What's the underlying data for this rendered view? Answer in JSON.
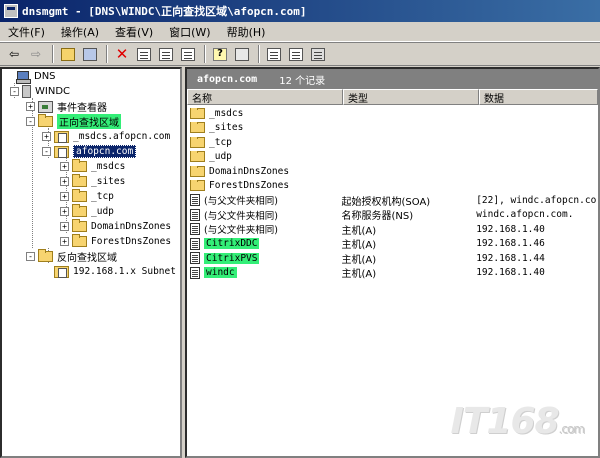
{
  "window": {
    "title": "dnsmgmt - [DNS\\WINDC\\正向查找区域\\afopcn.com]"
  },
  "menu": [
    "文件(F)",
    "操作(A)",
    "查看(V)",
    "窗口(W)",
    "帮助(H)"
  ],
  "tree": {
    "root": "DNS",
    "server": "WINDC",
    "event_viewer": "事件查看器",
    "forward_zone": "正向查找区域",
    "msdcs_zone": "_msdcs.afopcn.com",
    "selected_zone": "afopcn.com",
    "subfolders": [
      "_msdcs",
      "_sites",
      "_tcp",
      "_udp",
      "DomainDnsZones",
      "ForestDnsZones"
    ],
    "reverse_zone": "反向查找区域",
    "reverse_subnet": "192.168.1.x Subnet"
  },
  "right_pane": {
    "zone_name": "afopcn.com",
    "record_count": "12 个记录",
    "columns": {
      "name": "名称",
      "type": "类型",
      "data": "数据"
    },
    "rows": [
      {
        "name": "_msdcs",
        "type": "",
        "data": "",
        "kind": "folder",
        "highlight": false
      },
      {
        "name": "_sites",
        "type": "",
        "data": "",
        "kind": "folder",
        "highlight": false
      },
      {
        "name": "_tcp",
        "type": "",
        "data": "",
        "kind": "folder",
        "highlight": false
      },
      {
        "name": "_udp",
        "type": "",
        "data": "",
        "kind": "folder",
        "highlight": false
      },
      {
        "name": "DomainDnsZones",
        "type": "",
        "data": "",
        "kind": "folder",
        "highlight": false
      },
      {
        "name": "ForestDnsZones",
        "type": "",
        "data": "",
        "kind": "folder",
        "highlight": false
      },
      {
        "name": "(与父文件夹相同)",
        "type": "起始授权机构(SOA)",
        "data": "[22], windc.afopcn.co..",
        "kind": "record",
        "highlight": false
      },
      {
        "name": "(与父文件夹相同)",
        "type": "名称服务器(NS)",
        "data": "windc.afopcn.com.",
        "kind": "record",
        "highlight": false
      },
      {
        "name": "(与父文件夹相同)",
        "type": "主机(A)",
        "data": "192.168.1.40",
        "kind": "record",
        "highlight": false
      },
      {
        "name": "CitrixDDC",
        "type": "主机(A)",
        "data": "192.168.1.46",
        "kind": "record",
        "highlight": true
      },
      {
        "name": "CitrixPVS",
        "type": "主机(A)",
        "data": "192.168.1.44",
        "kind": "record",
        "highlight": true
      },
      {
        "name": "windc",
        "type": "主机(A)",
        "data": "192.168.1.40",
        "kind": "record",
        "highlight": true
      }
    ]
  },
  "watermark": {
    "text": "IT168",
    "suffix": ".com"
  },
  "colors": {
    "highlight": "#33ee77",
    "selection": "#0a246a",
    "title_bar": "#0a246a"
  }
}
